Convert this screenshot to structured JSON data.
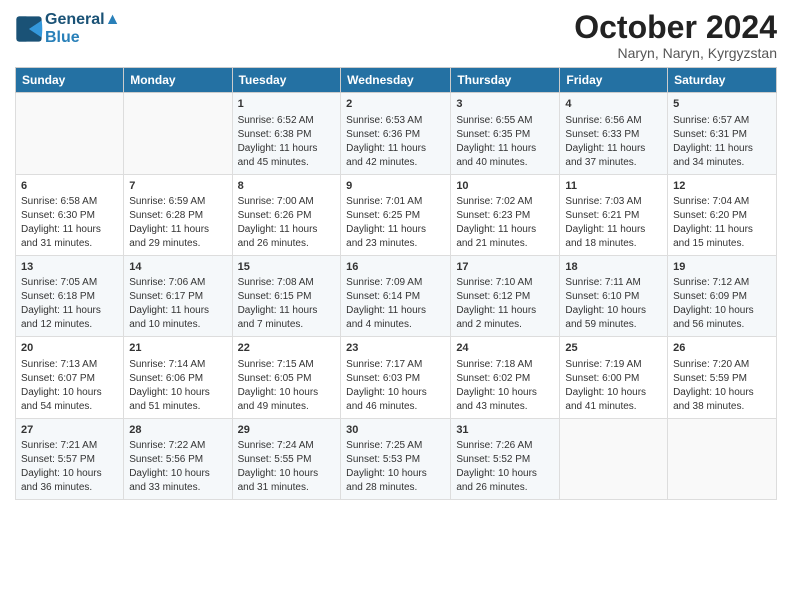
{
  "logo": {
    "line1": "General",
    "line2": "Blue"
  },
  "title": "October 2024",
  "subtitle": "Naryn, Naryn, Kyrgyzstan",
  "headers": [
    "Sunday",
    "Monday",
    "Tuesday",
    "Wednesday",
    "Thursday",
    "Friday",
    "Saturday"
  ],
  "weeks": [
    [
      {
        "day": "",
        "sunrise": "",
        "sunset": "",
        "daylight": ""
      },
      {
        "day": "",
        "sunrise": "",
        "sunset": "",
        "daylight": ""
      },
      {
        "day": "1",
        "sunrise": "Sunrise: 6:52 AM",
        "sunset": "Sunset: 6:38 PM",
        "daylight": "Daylight: 11 hours and 45 minutes."
      },
      {
        "day": "2",
        "sunrise": "Sunrise: 6:53 AM",
        "sunset": "Sunset: 6:36 PM",
        "daylight": "Daylight: 11 hours and 42 minutes."
      },
      {
        "day": "3",
        "sunrise": "Sunrise: 6:55 AM",
        "sunset": "Sunset: 6:35 PM",
        "daylight": "Daylight: 11 hours and 40 minutes."
      },
      {
        "day": "4",
        "sunrise": "Sunrise: 6:56 AM",
        "sunset": "Sunset: 6:33 PM",
        "daylight": "Daylight: 11 hours and 37 minutes."
      },
      {
        "day": "5",
        "sunrise": "Sunrise: 6:57 AM",
        "sunset": "Sunset: 6:31 PM",
        "daylight": "Daylight: 11 hours and 34 minutes."
      }
    ],
    [
      {
        "day": "6",
        "sunrise": "Sunrise: 6:58 AM",
        "sunset": "Sunset: 6:30 PM",
        "daylight": "Daylight: 11 hours and 31 minutes."
      },
      {
        "day": "7",
        "sunrise": "Sunrise: 6:59 AM",
        "sunset": "Sunset: 6:28 PM",
        "daylight": "Daylight: 11 hours and 29 minutes."
      },
      {
        "day": "8",
        "sunrise": "Sunrise: 7:00 AM",
        "sunset": "Sunset: 6:26 PM",
        "daylight": "Daylight: 11 hours and 26 minutes."
      },
      {
        "day": "9",
        "sunrise": "Sunrise: 7:01 AM",
        "sunset": "Sunset: 6:25 PM",
        "daylight": "Daylight: 11 hours and 23 minutes."
      },
      {
        "day": "10",
        "sunrise": "Sunrise: 7:02 AM",
        "sunset": "Sunset: 6:23 PM",
        "daylight": "Daylight: 11 hours and 21 minutes."
      },
      {
        "day": "11",
        "sunrise": "Sunrise: 7:03 AM",
        "sunset": "Sunset: 6:21 PM",
        "daylight": "Daylight: 11 hours and 18 minutes."
      },
      {
        "day": "12",
        "sunrise": "Sunrise: 7:04 AM",
        "sunset": "Sunset: 6:20 PM",
        "daylight": "Daylight: 11 hours and 15 minutes."
      }
    ],
    [
      {
        "day": "13",
        "sunrise": "Sunrise: 7:05 AM",
        "sunset": "Sunset: 6:18 PM",
        "daylight": "Daylight: 11 hours and 12 minutes."
      },
      {
        "day": "14",
        "sunrise": "Sunrise: 7:06 AM",
        "sunset": "Sunset: 6:17 PM",
        "daylight": "Daylight: 11 hours and 10 minutes."
      },
      {
        "day": "15",
        "sunrise": "Sunrise: 7:08 AM",
        "sunset": "Sunset: 6:15 PM",
        "daylight": "Daylight: 11 hours and 7 minutes."
      },
      {
        "day": "16",
        "sunrise": "Sunrise: 7:09 AM",
        "sunset": "Sunset: 6:14 PM",
        "daylight": "Daylight: 11 hours and 4 minutes."
      },
      {
        "day": "17",
        "sunrise": "Sunrise: 7:10 AM",
        "sunset": "Sunset: 6:12 PM",
        "daylight": "Daylight: 11 hours and 2 minutes."
      },
      {
        "day": "18",
        "sunrise": "Sunrise: 7:11 AM",
        "sunset": "Sunset: 6:10 PM",
        "daylight": "Daylight: 10 hours and 59 minutes."
      },
      {
        "day": "19",
        "sunrise": "Sunrise: 7:12 AM",
        "sunset": "Sunset: 6:09 PM",
        "daylight": "Daylight: 10 hours and 56 minutes."
      }
    ],
    [
      {
        "day": "20",
        "sunrise": "Sunrise: 7:13 AM",
        "sunset": "Sunset: 6:07 PM",
        "daylight": "Daylight: 10 hours and 54 minutes."
      },
      {
        "day": "21",
        "sunrise": "Sunrise: 7:14 AM",
        "sunset": "Sunset: 6:06 PM",
        "daylight": "Daylight: 10 hours and 51 minutes."
      },
      {
        "day": "22",
        "sunrise": "Sunrise: 7:15 AM",
        "sunset": "Sunset: 6:05 PM",
        "daylight": "Daylight: 10 hours and 49 minutes."
      },
      {
        "day": "23",
        "sunrise": "Sunrise: 7:17 AM",
        "sunset": "Sunset: 6:03 PM",
        "daylight": "Daylight: 10 hours and 46 minutes."
      },
      {
        "day": "24",
        "sunrise": "Sunrise: 7:18 AM",
        "sunset": "Sunset: 6:02 PM",
        "daylight": "Daylight: 10 hours and 43 minutes."
      },
      {
        "day": "25",
        "sunrise": "Sunrise: 7:19 AM",
        "sunset": "Sunset: 6:00 PM",
        "daylight": "Daylight: 10 hours and 41 minutes."
      },
      {
        "day": "26",
        "sunrise": "Sunrise: 7:20 AM",
        "sunset": "Sunset: 5:59 PM",
        "daylight": "Daylight: 10 hours and 38 minutes."
      }
    ],
    [
      {
        "day": "27",
        "sunrise": "Sunrise: 7:21 AM",
        "sunset": "Sunset: 5:57 PM",
        "daylight": "Daylight: 10 hours and 36 minutes."
      },
      {
        "day": "28",
        "sunrise": "Sunrise: 7:22 AM",
        "sunset": "Sunset: 5:56 PM",
        "daylight": "Daylight: 10 hours and 33 minutes."
      },
      {
        "day": "29",
        "sunrise": "Sunrise: 7:24 AM",
        "sunset": "Sunset: 5:55 PM",
        "daylight": "Daylight: 10 hours and 31 minutes."
      },
      {
        "day": "30",
        "sunrise": "Sunrise: 7:25 AM",
        "sunset": "Sunset: 5:53 PM",
        "daylight": "Daylight: 10 hours and 28 minutes."
      },
      {
        "day": "31",
        "sunrise": "Sunrise: 7:26 AM",
        "sunset": "Sunset: 5:52 PM",
        "daylight": "Daylight: 10 hours and 26 minutes."
      },
      {
        "day": "",
        "sunrise": "",
        "sunset": "",
        "daylight": ""
      },
      {
        "day": "",
        "sunrise": "",
        "sunset": "",
        "daylight": ""
      }
    ]
  ]
}
